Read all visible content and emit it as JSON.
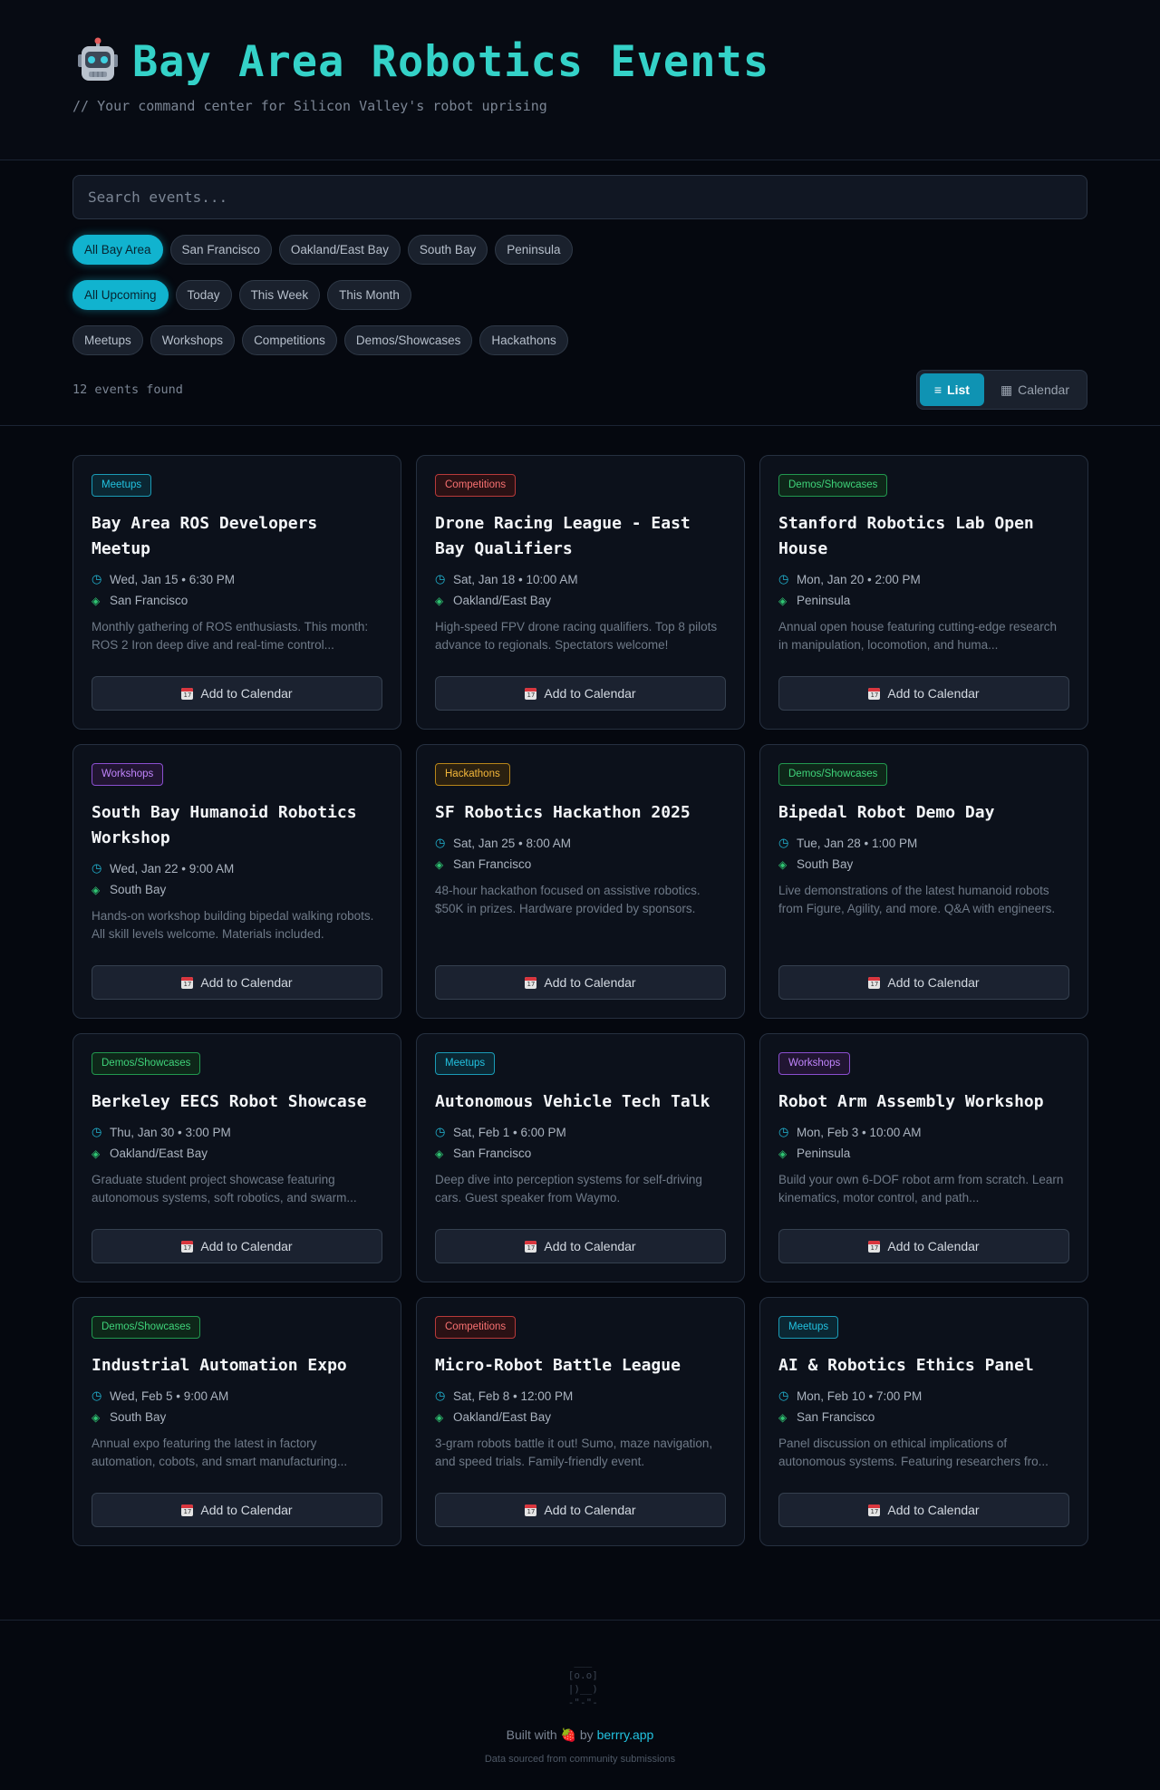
{
  "header": {
    "title": "Bay Area Robotics Events",
    "tagline": "// Your command center for Silicon Valley's robot uprising",
    "logo_icon": "robot-icon"
  },
  "search": {
    "placeholder": "Search events..."
  },
  "filters": {
    "regions": [
      "All Bay Area",
      "San Francisco",
      "Oakland/East Bay",
      "South Bay",
      "Peninsula"
    ],
    "times": [
      "All Upcoming",
      "Today",
      "This Week",
      "This Month"
    ],
    "categories": [
      "Meetups",
      "Workshops",
      "Competitions",
      "Demos/Showcases",
      "Hackathons"
    ],
    "active_region": "All Bay Area",
    "active_time": "All Upcoming"
  },
  "results": {
    "count_text": "12 events found"
  },
  "view_toggle": {
    "list_label": "List",
    "calendar_label": "Calendar",
    "list_icon": "≡",
    "calendar_icon": "▦"
  },
  "events": [
    {
      "category": "Meetups",
      "type": "meetups",
      "title": "Bay Area ROS Developers Meetup",
      "datetime": "Wed, Jan 15 • 6:30 PM",
      "location": "San Francisco",
      "description": "Monthly gathering of ROS enthusiasts. This month: ROS 2 Iron deep dive and real-time control..."
    },
    {
      "category": "Competitions",
      "type": "competitions",
      "title": "Drone Racing League - East Bay Qualifiers",
      "datetime": "Sat, Jan 18 • 10:00 AM",
      "location": "Oakland/East Bay",
      "description": "High-speed FPV drone racing qualifiers. Top 8 pilots advance to regionals. Spectators welcome!"
    },
    {
      "category": "Demos/Showcases",
      "type": "demos",
      "title": "Stanford Robotics Lab Open House",
      "datetime": "Mon, Jan 20 • 2:00 PM",
      "location": "Peninsula",
      "description": "Annual open house featuring cutting-edge research in manipulation, locomotion, and huma..."
    },
    {
      "category": "Workshops",
      "type": "workshops",
      "title": "South Bay Humanoid Robotics Workshop",
      "datetime": "Wed, Jan 22 • 9:00 AM",
      "location": "South Bay",
      "description": "Hands-on workshop building bipedal walking robots. All skill levels welcome. Materials included."
    },
    {
      "category": "Hackathons",
      "type": "hackathons",
      "title": "SF Robotics Hackathon 2025",
      "datetime": "Sat, Jan 25 • 8:00 AM",
      "location": "San Francisco",
      "description": "48-hour hackathon focused on assistive robotics. $50K in prizes. Hardware provided by sponsors."
    },
    {
      "category": "Demos/Showcases",
      "type": "demos",
      "title": "Bipedal Robot Demo Day",
      "datetime": "Tue, Jan 28 • 1:00 PM",
      "location": "South Bay",
      "description": "Live demonstrations of the latest humanoid robots from Figure, Agility, and more. Q&A with engineers."
    },
    {
      "category": "Demos/Showcases",
      "type": "demos",
      "title": "Berkeley EECS Robot Showcase",
      "datetime": "Thu, Jan 30 • 3:00 PM",
      "location": "Oakland/East Bay",
      "description": "Graduate student project showcase featuring autonomous systems, soft robotics, and swarm..."
    },
    {
      "category": "Meetups",
      "type": "meetups",
      "title": "Autonomous Vehicle Tech Talk",
      "datetime": "Sat, Feb 1 • 6:00 PM",
      "location": "San Francisco",
      "description": "Deep dive into perception systems for self-driving cars. Guest speaker from Waymo."
    },
    {
      "category": "Workshops",
      "type": "workshops",
      "title": "Robot Arm Assembly Workshop",
      "datetime": "Mon, Feb 3 • 10:00 AM",
      "location": "Peninsula",
      "description": "Build your own 6-DOF robot arm from scratch. Learn kinematics, motor control, and path..."
    },
    {
      "category": "Demos/Showcases",
      "type": "demos",
      "title": "Industrial Automation Expo",
      "datetime": "Wed, Feb 5 • 9:00 AM",
      "location": "South Bay",
      "description": "Annual expo featuring the latest in factory automation, cobots, and smart manufacturing..."
    },
    {
      "category": "Competitions",
      "type": "competitions",
      "title": "Micro-Robot Battle League",
      "datetime": "Sat, Feb 8 • 12:00 PM",
      "location": "Oakland/East Bay",
      "description": "3-gram robots battle it out! Sumo, maze navigation, and speed trials. Family-friendly event."
    },
    {
      "category": "Meetups",
      "type": "meetups",
      "title": "AI & Robotics Ethics Panel",
      "datetime": "Mon, Feb 10 • 7:00 PM",
      "location": "San Francisco",
      "description": "Panel discussion on ethical implications of autonomous systems. Featuring researchers fro..."
    }
  ],
  "card_button_label": "Add to Calendar",
  "footer": {
    "ascii_art": "  ___\n [o.o]\n |)__)\n -\"-\"-",
    "built_prefix": "Built with",
    "built_by": "by",
    "link_text": "berrry.app",
    "sourced": "Data sourced from community submissions",
    "heart_icon": "strawberry-icon"
  },
  "colors": {
    "accent": "#11b3cf",
    "title": "#34d2c8",
    "background": "#05080f"
  }
}
